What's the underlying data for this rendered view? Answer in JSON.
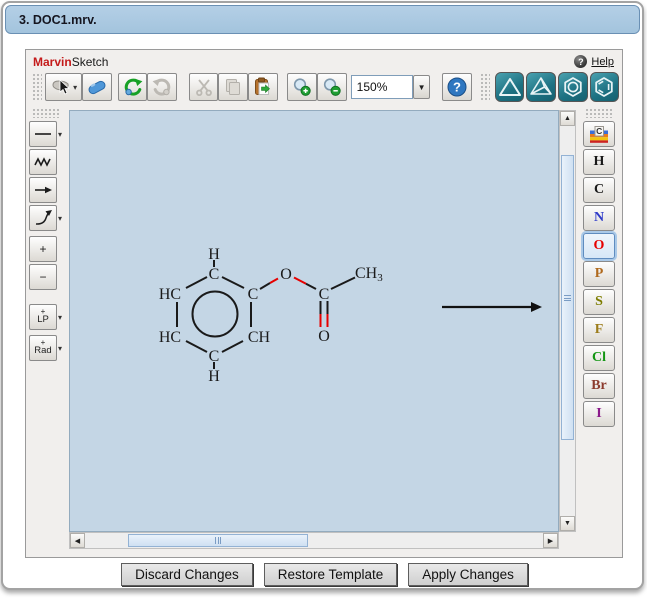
{
  "window": {
    "title": "3. DOC1.mrv."
  },
  "applet": {
    "brand_marvin": "Marvin",
    "brand_sketch": "Sketch",
    "help_label": "Help",
    "zoom_value": "150%"
  },
  "left_toolbar": {
    "plus_label": "+",
    "minus_label": "−",
    "lp_label": "LP",
    "rad_label": "Rad",
    "increment_mark": "+"
  },
  "element_toolbar": {
    "periodic_tile_letter": "C",
    "elements": [
      {
        "symbol": "H",
        "color": "#1a1a1a",
        "selected": false
      },
      {
        "symbol": "C",
        "color": "#1a1a1a",
        "selected": false
      },
      {
        "symbol": "N",
        "color": "#2f3bc8",
        "selected": false
      },
      {
        "symbol": "O",
        "color": "#e60000",
        "selected": true
      },
      {
        "symbol": "P",
        "color": "#b06a1e",
        "selected": false
      },
      {
        "symbol": "S",
        "color": "#7d7d00",
        "selected": false
      },
      {
        "symbol": "F",
        "color": "#9c7c1a",
        "selected": false
      },
      {
        "symbol": "Cl",
        "color": "#149614",
        "selected": false
      },
      {
        "symbol": "Br",
        "color": "#8c3b2e",
        "selected": false
      },
      {
        "symbol": "I",
        "color": "#8b1a8b",
        "selected": false
      }
    ]
  },
  "molecule": {
    "atoms": {
      "h_top": "H",
      "c_top": "C",
      "hc_upper_left": "HC",
      "hc_lower_left": "HC",
      "c_bottom": "C",
      "h_bottom": "H",
      "c_ring_right": "C",
      "ch_lower_right": "CH",
      "o_ester": "O",
      "c_carbonyl": "C",
      "o_carbonyl": "O",
      "ch3_main": "CH",
      "ch3_sub": "3"
    },
    "heteroatom_color": "#e60000",
    "carbon_color": "#1a1a1a"
  },
  "footer": {
    "discard_label": "Discard Changes",
    "restore_label": "Restore Template",
    "apply_label": "Apply Changes"
  },
  "colors": {
    "title_bar_bg": "#abc9e2",
    "canvas_bg": "#c4d6e5",
    "template_button_bg": "#1d7182",
    "marvin_red": "#c41a1a"
  }
}
